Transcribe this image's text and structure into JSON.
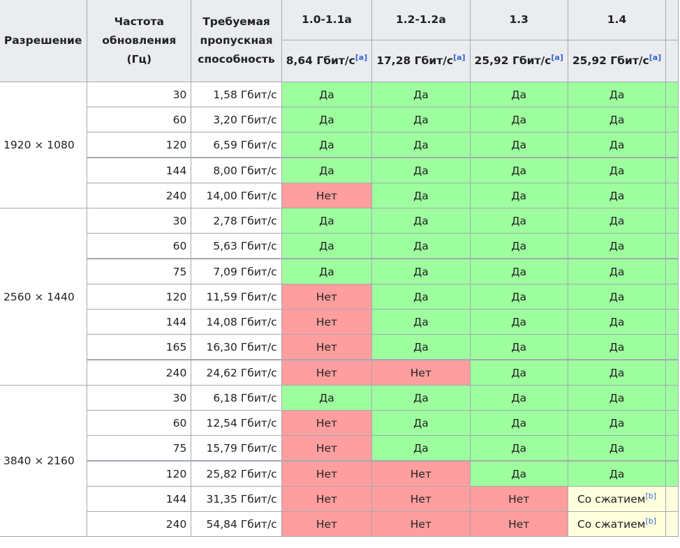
{
  "headers": {
    "resolution": "Разрешение",
    "refresh": "Частота обновления (Гц)",
    "bandwidth": "Требуемая пропускная способность",
    "versions": [
      {
        "label": "1.0-1.1a",
        "rate": "8,64 Гбит/с",
        "note": "[a]"
      },
      {
        "label": "1.2-1.2a",
        "rate": "17,28 Гбит/с",
        "note": "[a]"
      },
      {
        "label": "1.3",
        "rate": "25,92 Гбит/с",
        "note": "[a]"
      },
      {
        "label": "1.4",
        "rate": "25,92 Гбит/с",
        "note": "[a]"
      }
    ]
  },
  "groups": [
    {
      "resolution": "1920 × 1080",
      "rows": [
        {
          "hz": "30",
          "bw": "1,58 Гбит/с",
          "cells": [
            {
              "t": "Да",
              "s": "yes"
            },
            {
              "t": "Да",
              "s": "yes"
            },
            {
              "t": "Да",
              "s": "yes"
            },
            {
              "t": "Да",
              "s": "yes"
            }
          ]
        },
        {
          "hz": "60",
          "bw": "3,20 Гбит/с",
          "cells": [
            {
              "t": "Да",
              "s": "yes"
            },
            {
              "t": "Да",
              "s": "yes"
            },
            {
              "t": "Да",
              "s": "yes"
            },
            {
              "t": "Да",
              "s": "yes"
            }
          ]
        },
        {
          "hz": "120",
          "bw": "6,59 Гбит/с",
          "cells": [
            {
              "t": "Да",
              "s": "yes"
            },
            {
              "t": "Да",
              "s": "yes"
            },
            {
              "t": "Да",
              "s": "yes"
            },
            {
              "t": "Да",
              "s": "yes"
            }
          ]
        },
        {
          "hz": "144",
          "bw": "8,00 Гбит/с",
          "thick": true,
          "cells": [
            {
              "t": "Да",
              "s": "yes"
            },
            {
              "t": "Да",
              "s": "yes"
            },
            {
              "t": "Да",
              "s": "yes"
            },
            {
              "t": "Да",
              "s": "yes"
            }
          ]
        },
        {
          "hz": "240",
          "bw": "14,00 Гбит/с",
          "cells": [
            {
              "t": "Нет",
              "s": "no"
            },
            {
              "t": "Да",
              "s": "yes"
            },
            {
              "t": "Да",
              "s": "yes"
            },
            {
              "t": "Да",
              "s": "yes"
            }
          ]
        }
      ]
    },
    {
      "resolution": "2560 × 1440",
      "rows": [
        {
          "hz": "30",
          "bw": "2,78 Гбит/с",
          "cells": [
            {
              "t": "Да",
              "s": "yes"
            },
            {
              "t": "Да",
              "s": "yes"
            },
            {
              "t": "Да",
              "s": "yes"
            },
            {
              "t": "Да",
              "s": "yes"
            }
          ]
        },
        {
          "hz": "60",
          "bw": "5,63 Гбит/с",
          "cells": [
            {
              "t": "Да",
              "s": "yes"
            },
            {
              "t": "Да",
              "s": "yes"
            },
            {
              "t": "Да",
              "s": "yes"
            },
            {
              "t": "Да",
              "s": "yes"
            }
          ]
        },
        {
          "hz": "75",
          "bw": "7,09 Гбит/с",
          "thick": true,
          "cells": [
            {
              "t": "Да",
              "s": "yes"
            },
            {
              "t": "Да",
              "s": "yes"
            },
            {
              "t": "Да",
              "s": "yes"
            },
            {
              "t": "Да",
              "s": "yes"
            }
          ]
        },
        {
          "hz": "120",
          "bw": "11,59 Гбит/с",
          "cells": [
            {
              "t": "Нет",
              "s": "no"
            },
            {
              "t": "Да",
              "s": "yes"
            },
            {
              "t": "Да",
              "s": "yes"
            },
            {
              "t": "Да",
              "s": "yes"
            }
          ]
        },
        {
          "hz": "144",
          "bw": "14,08 Гбит/с",
          "cells": [
            {
              "t": "Нет",
              "s": "no"
            },
            {
              "t": "Да",
              "s": "yes"
            },
            {
              "t": "Да",
              "s": "yes"
            },
            {
              "t": "Да",
              "s": "yes"
            }
          ]
        },
        {
          "hz": "165",
          "bw": "16,30 Гбит/с",
          "cells": [
            {
              "t": "Нет",
              "s": "no"
            },
            {
              "t": "Да",
              "s": "yes"
            },
            {
              "t": "Да",
              "s": "yes"
            },
            {
              "t": "Да",
              "s": "yes"
            }
          ]
        },
        {
          "hz": "240",
          "bw": "24,62 Гбит/с",
          "thick": true,
          "cells": [
            {
              "t": "Нет",
              "s": "no"
            },
            {
              "t": "Нет",
              "s": "no"
            },
            {
              "t": "Да",
              "s": "yes"
            },
            {
              "t": "Да",
              "s": "yes"
            }
          ]
        }
      ]
    },
    {
      "resolution": "3840 × 2160",
      "rows": [
        {
          "hz": "30",
          "bw": "6,18 Гбит/с",
          "cells": [
            {
              "t": "Да",
              "s": "yes"
            },
            {
              "t": "Да",
              "s": "yes"
            },
            {
              "t": "Да",
              "s": "yes"
            },
            {
              "t": "Да",
              "s": "yes"
            }
          ]
        },
        {
          "hz": "60",
          "bw": "12,54 Гбит/с",
          "cells": [
            {
              "t": "Нет",
              "s": "no"
            },
            {
              "t": "Да",
              "s": "yes"
            },
            {
              "t": "Да",
              "s": "yes"
            },
            {
              "t": "Да",
              "s": "yes"
            }
          ]
        },
        {
          "hz": "75",
          "bw": "15,79 Гбит/с",
          "cells": [
            {
              "t": "Нет",
              "s": "no"
            },
            {
              "t": "Да",
              "s": "yes"
            },
            {
              "t": "Да",
              "s": "yes"
            },
            {
              "t": "Да",
              "s": "yes"
            }
          ]
        },
        {
          "hz": "120",
          "bw": "25,82 Гбит/с",
          "thick": true,
          "cells": [
            {
              "t": "Нет",
              "s": "no"
            },
            {
              "t": "Нет",
              "s": "no"
            },
            {
              "t": "Да",
              "s": "yes"
            },
            {
              "t": "Да",
              "s": "yes"
            }
          ]
        },
        {
          "hz": "144",
          "bw": "31,35 Гбит/с",
          "cells": [
            {
              "t": "Нет",
              "s": "no"
            },
            {
              "t": "Нет",
              "s": "no"
            },
            {
              "t": "Нет",
              "s": "no"
            },
            {
              "t": "Со сжатием",
              "s": "part",
              "note": "[b]"
            }
          ]
        },
        {
          "hz": "240",
          "bw": "54,84 Гбит/с",
          "cells": [
            {
              "t": "Нет",
              "s": "no"
            },
            {
              "t": "Нет",
              "s": "no"
            },
            {
              "t": "Нет",
              "s": "no"
            },
            {
              "t": "Со сжатием",
              "s": "part",
              "note": "[b]"
            }
          ]
        }
      ]
    }
  ],
  "colors": {
    "yes": "#9eff9e",
    "no": "#ff9e9e",
    "partial": "#ffffdd",
    "header": "#eaecf0",
    "border": "#a2a9b1"
  }
}
